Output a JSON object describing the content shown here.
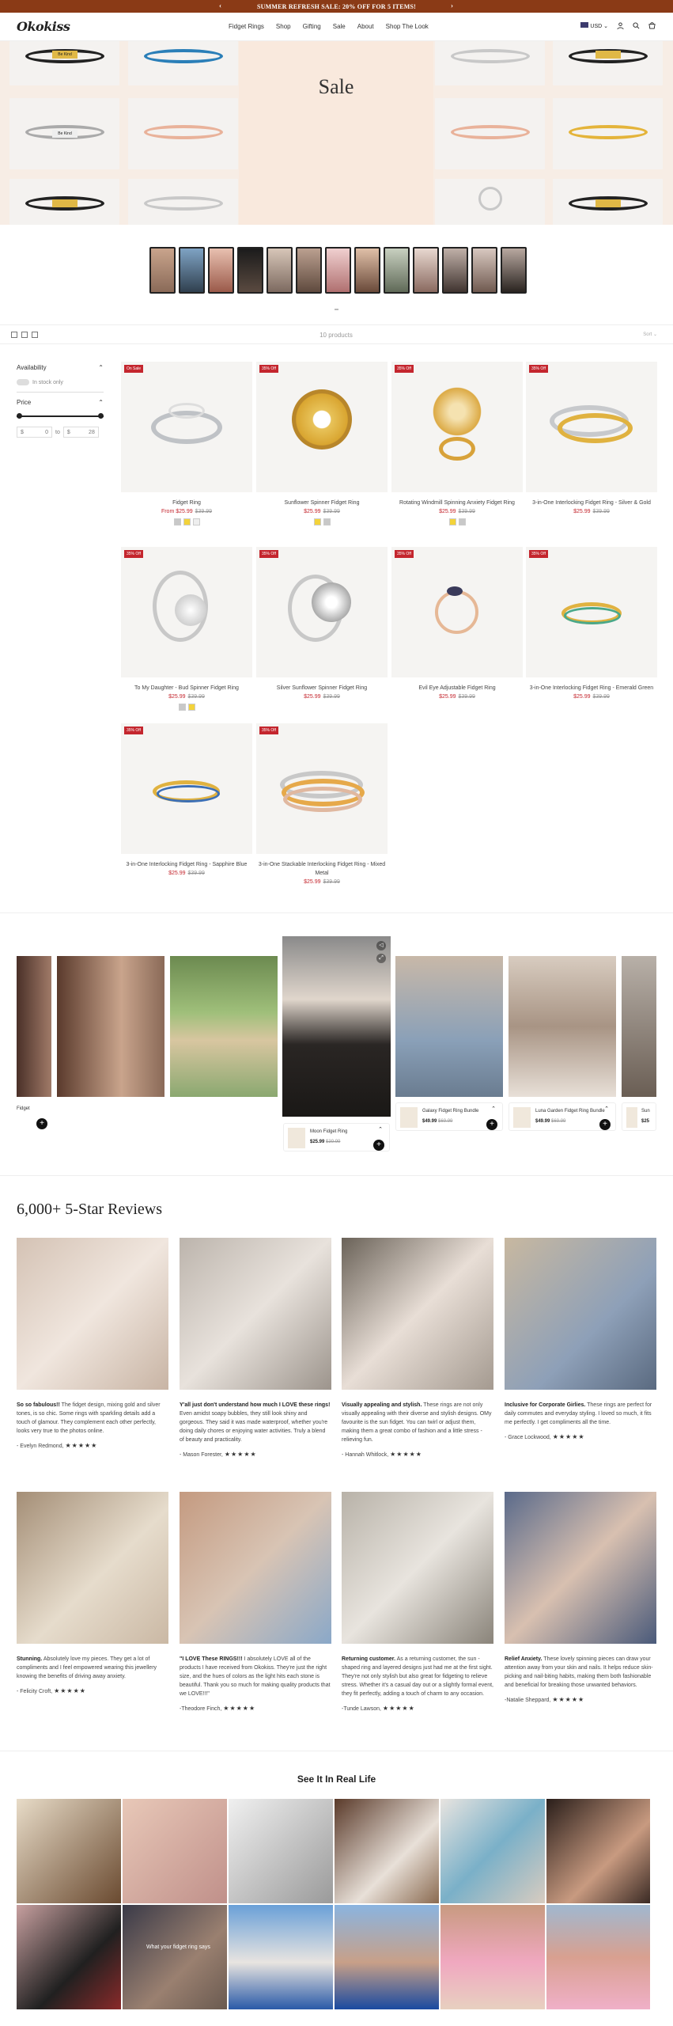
{
  "topbar": {
    "text": "SUMMER REFRESH SALE: 20% OFF FOR 5 ITEMS!"
  },
  "header": {
    "logo": "Okokiss",
    "nav": [
      "Fidget Rings",
      "Shop",
      "Gifting",
      "Sale",
      "About",
      "Shop The Look"
    ],
    "currency": "USD"
  },
  "sale_banner": {
    "title": "Sale"
  },
  "toolbar": {
    "product_count": "10 products",
    "sort_label": "Sort"
  },
  "filters": {
    "availability": "Availability",
    "in_stock_only": "In stock only",
    "price": "Price",
    "min_currency": "$",
    "min_value": "0",
    "to": "to",
    "max_currency": "$",
    "max_value": "28"
  },
  "products": [
    {
      "name": "Fidget Ring",
      "price_prefix": "From ",
      "price": "$25.99",
      "compare": "$39.99",
      "badge": "On Sale"
    },
    {
      "name": "Sunflower Spinner Fidget Ring",
      "price": "$25.99",
      "compare": "$39.99",
      "badge": "35% Off"
    },
    {
      "name": "Rotating Windmill Spinning Anxiety Fidget Ring",
      "price": "$25.99",
      "compare": "$39.99",
      "badge": "35% Off"
    },
    {
      "name": "3-in-One Interlocking Fidget Ring - Silver & Gold",
      "price": "$25.99",
      "compare": "$39.99",
      "badge": "35% Off"
    },
    {
      "name": "To My Daughter - Bud Spinner Fidget Ring",
      "price": "$25.99",
      "compare": "$39.99",
      "badge": "35% Off"
    },
    {
      "name": "Silver Sunflower Spinner Fidget Ring",
      "price": "$25.99",
      "compare": "$39.99",
      "badge": "35% Off"
    },
    {
      "name": "Evil Eye Adjustable Fidget Ring",
      "price": "$25.99",
      "compare": "$39.99",
      "badge": "35% Off"
    },
    {
      "name": "3-in-One Interlocking Fidget Ring - Emerald Green",
      "price": "$25.99",
      "compare": "$39.99",
      "badge": "35% Off"
    },
    {
      "name": "3-in-One Interlocking Fidget Ring - Sapphire Blue",
      "price": "$25.99",
      "compare": "$39.99",
      "badge": "35% Off"
    },
    {
      "name": "3-in-One Stackable Interlocking Fidget Ring - Mixed Metal",
      "price": "$25.99",
      "compare": "$39.99",
      "badge": "35% Off"
    }
  ],
  "videos": {
    "left_label": "Fidget",
    "center": {
      "name": "Moon Fidget Ring",
      "price": "$25.99",
      "compare": "$39.99"
    },
    "right1": {
      "name": "Galaxy Fidget Ring Bundle",
      "price": "$49.99",
      "compare": "$69.99"
    },
    "right2": {
      "name": "Luna Garden Fidget Ring Bundle",
      "price": "$49.99",
      "compare": "$69.99"
    },
    "right3": {
      "name": "Sun",
      "price": "$25"
    }
  },
  "reviews": {
    "title": "6,000+ 5-Star Reviews",
    "stars": "★★★★★",
    "items": [
      {
        "title": "So so fabulous!!",
        "text": " The fidget design, mixing gold and silver tones, is so chic. Some rings with sparkling details add a touch of glamour. They complement each other perfectly, looks very true to the photos online.",
        "author": "- Evelyn Redmond,"
      },
      {
        "title": "Y'all just don't understand how much I LOVE these rings!",
        "text": " Even amidst soapy bubbles, they still look shiny and gorgeous. They said it was made waterproof, whether you're doing daily chores or enjoying water activities. Truly a blend of beauty and practicality.",
        "author": "- Mason Forester,"
      },
      {
        "title": "Visually appealing and stylish.",
        "text": " These rings are not only visually appealing with their diverse and stylish designs. OMy favourite is the sun fidget. You can twirl or adjust them, making them a great combo of fashion and a little stress - relieving fun.",
        "author": "- Hannah Whitlock,"
      },
      {
        "title": "Inclusive for Corporate Girlies.",
        "text": " These rings are perfect for daily commutes and everyday styling. I loved so much, it fits me perfectly. I get compliments all the time.",
        "author": "- Grace Lockwood,"
      },
      {
        "title": "Stunning.",
        "text": " Absolutely love my pieces. They get a lot of compliments and I feel empowered wearing this jewellery knowing the benefits of driving away anxiety.",
        "author": "- Felicity Croft,"
      },
      {
        "title": "\"I LOVE These RINGS!!!",
        "text": " I absolutely LOVE all of the products I have received from Okokiss. They're just the right size, and the hues of colors as the light hits each stone is beautiful. Thank you so much for making quality products that we LOVE!!!\"",
        "author": "-Theodore Finch,"
      },
      {
        "title": "Returning customer.",
        "text": " As a returning customer, the sun - shaped ring and layered designs just had me at the first sight. They're not only stylish but also great for fidgeting to relieve stress. Whether it's a casual day out or a slightly formal event, they fit perfectly, adding a touch of charm to any occasion.",
        "author": "-Tunde Lawson,"
      },
      {
        "title": "Relief Anxiety.",
        "text": " These lovely spinning pieces can draw your attention away from your skin and nails. It helps reduce skin-picking and nail-biting habits, making them both fashionable and beneficial for breaking those unwanted behaviors.",
        "author": "-Natalie Sheppard,"
      }
    ]
  },
  "gallery": {
    "title": "See It In Real Life",
    "overlay_text": "What your fidget ring says"
  },
  "colors": {
    "accent": "#c4262e",
    "topbar": "#8a3a16",
    "banner": "#f7ede5"
  }
}
